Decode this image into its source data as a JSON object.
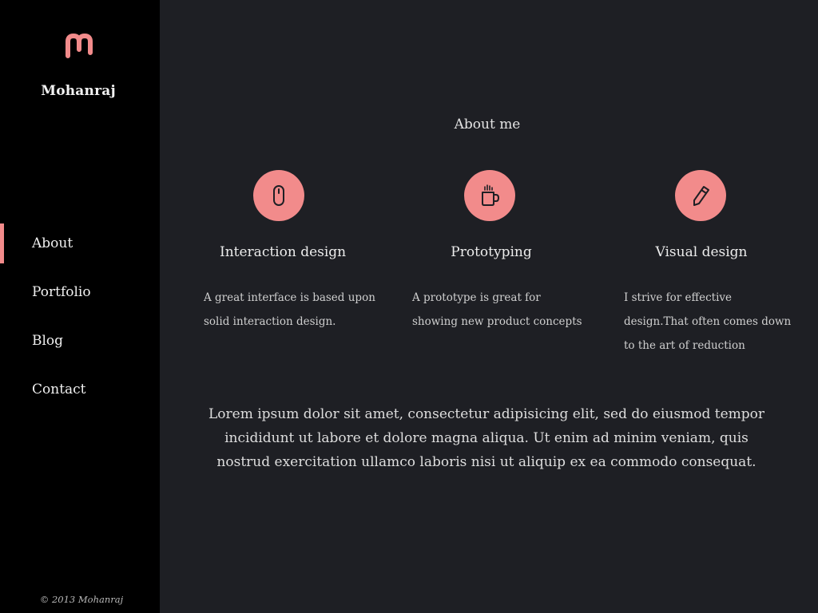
{
  "theme": {
    "accent": "#f28b8b",
    "sidebar_bg": "#000000",
    "main_bg": "#1e1f24",
    "icon_stroke": "#1e1f24"
  },
  "sidebar": {
    "logo_icon": "m-logo-icon",
    "brand": "Mohanraj",
    "nav": [
      {
        "label": "About",
        "active": true
      },
      {
        "label": "Portfolio",
        "active": false
      },
      {
        "label": "Blog",
        "active": false
      },
      {
        "label": "Contact",
        "active": false
      }
    ],
    "copyright": "© 2013  Mohanraj"
  },
  "main": {
    "title": "About me",
    "features": [
      {
        "icon": "mouse-icon",
        "title": "Interaction design",
        "text": "A great interface is based upon solid interaction design."
      },
      {
        "icon": "coffee-mug-icon",
        "title": "Prototyping",
        "text": "A prototype is great for showing new product concepts"
      },
      {
        "icon": "pencil-icon",
        "title": "Visual design",
        "text": "I strive for effective design.That often comes down to the art of reduction"
      }
    ],
    "lorem": "Lorem ipsum dolor sit amet, consectetur adipisicing elit, sed do eiusmod tempor incididunt ut labore et dolore magna aliqua. Ut enim ad minim veniam, quis nostrud exercitation ullamco laboris nisi ut aliquip ex ea commodo consequat."
  }
}
